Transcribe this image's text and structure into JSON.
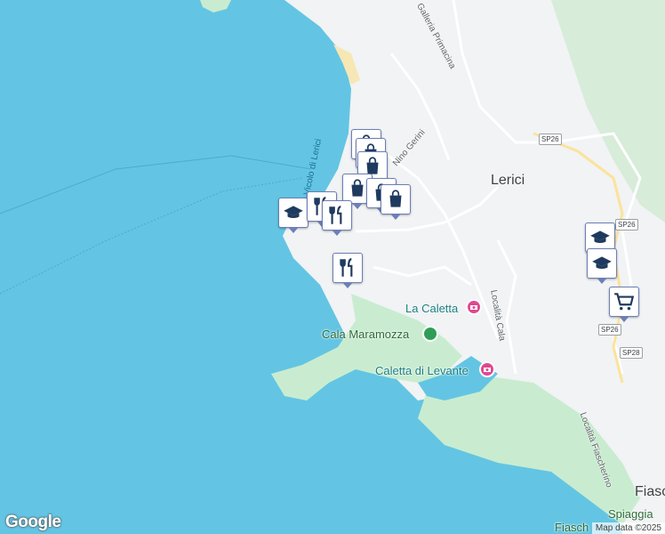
{
  "map": {
    "places": {
      "town": "Lerici",
      "fiascherino": "Fiasc",
      "spiaggia_line1": "Spiaggia",
      "spiaggia_line2": "Fiasch"
    },
    "pois": {
      "la_caletta": "La Caletta",
      "cala_maramozza": "Cala Maramozza",
      "caletta_levante": "Caletta di Levante"
    },
    "streets": {
      "galleria": "Galleria Primacina",
      "nino_gerini": "Nino Gerini",
      "vicolo": "Vicolo di Lerici",
      "localita_cala": "Località Cala",
      "localita_fiascherino": "Località Fiascherino"
    },
    "shields": {
      "sp26_a": "SP26",
      "sp26_b": "SP26",
      "sp26_c": "SP26",
      "sp28": "SP28"
    },
    "markers": [
      {
        "icon": "shopping-bag-icon"
      },
      {
        "icon": "shopping-bag-icon"
      },
      {
        "icon": "shopping-bag-icon"
      },
      {
        "icon": "shopping-bag-icon"
      },
      {
        "icon": "shopping-bag-icon"
      },
      {
        "icon": "shopping-bag-icon"
      },
      {
        "icon": "school-icon"
      },
      {
        "icon": "restaurant-icon"
      },
      {
        "icon": "restaurant-icon"
      },
      {
        "icon": "restaurant-icon"
      },
      {
        "icon": "school-icon"
      },
      {
        "icon": "school-icon"
      },
      {
        "icon": "shopping-cart-icon"
      }
    ],
    "colors": {
      "sea": "#63c5e3",
      "land": "#f1f3f4",
      "park": "#c9ecd0",
      "marker_border": "#6c7fb6",
      "marker_icon": "#1f3a5f"
    }
  },
  "footer": {
    "logo": "Google",
    "attribution": "Map data ©2025"
  }
}
